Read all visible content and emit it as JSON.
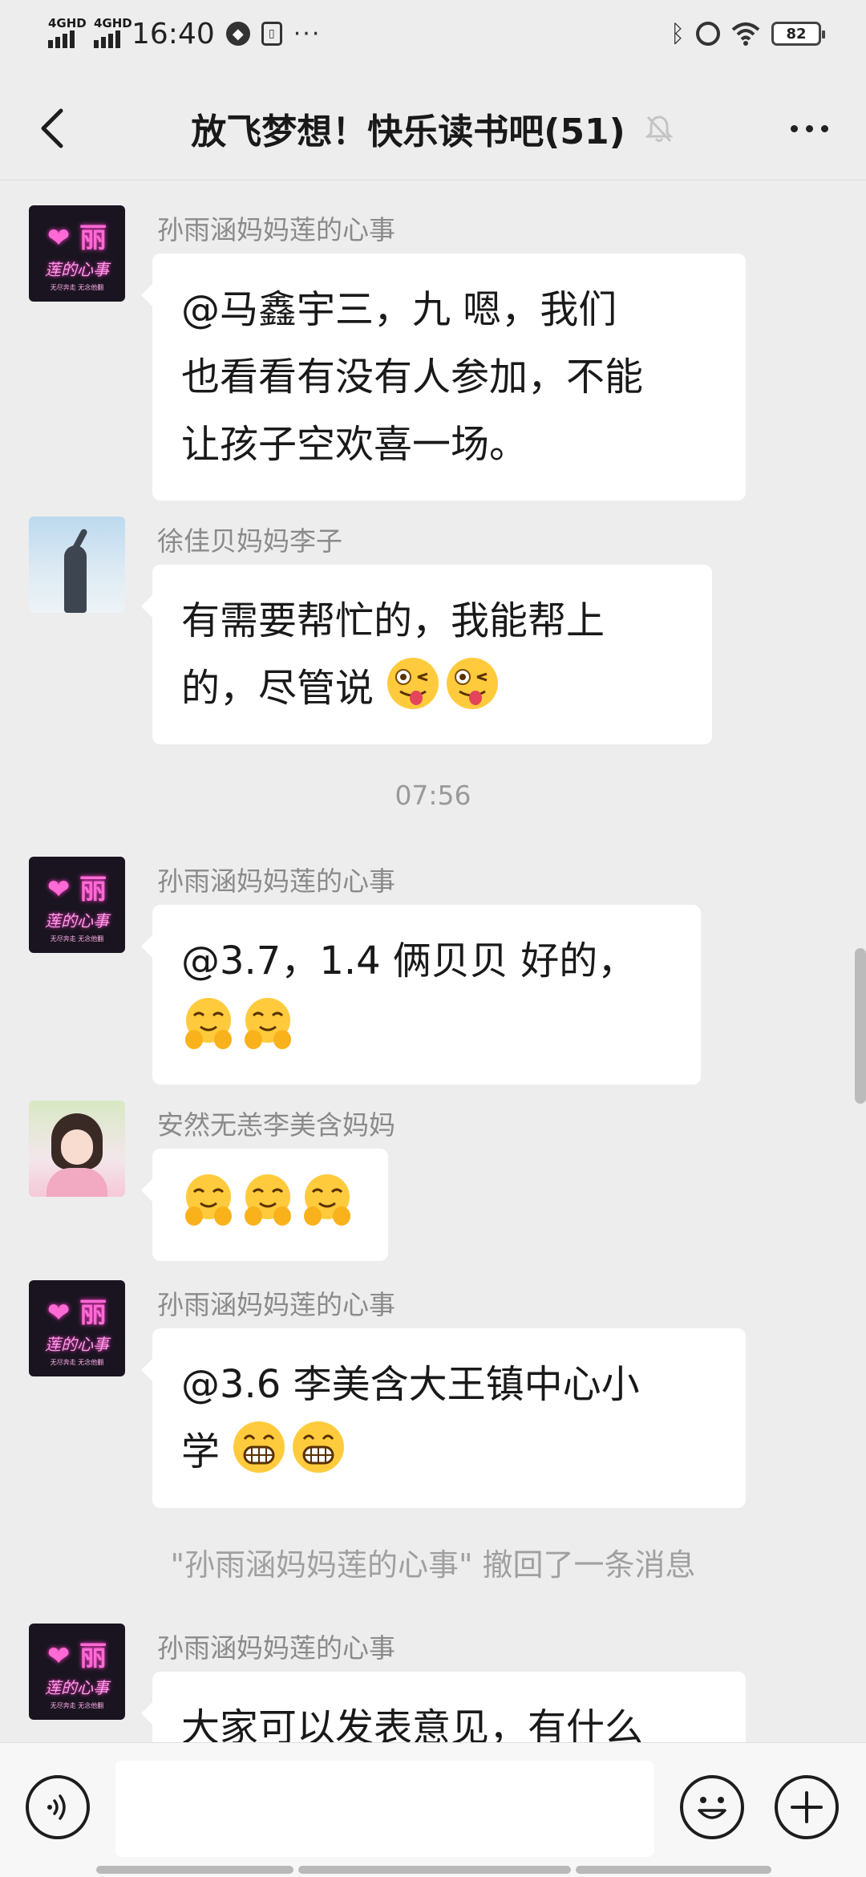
{
  "status_bar": {
    "signal_1": "4GHD",
    "signal_2": "4GHD",
    "time": "16:40",
    "more": "···",
    "battery": "82",
    "icons": [
      "signal-icon",
      "signal-icon",
      "app-notification-icon",
      "sim-icon",
      "bluetooth-icon",
      "alarm-icon",
      "wifi-icon",
      "battery-icon"
    ]
  },
  "header": {
    "title": "放飞梦想！快乐读书吧(51)",
    "icons": [
      "back-icon",
      "mute-bell-icon",
      "more-icon"
    ]
  },
  "messages": [
    {
      "sender": "孙雨涵妈妈莲的心事",
      "avatar": "neon-li",
      "avatar_text": {
        "top": "❤ 丽",
        "mid": "莲的心事",
        "bottom": "无尽奔走 无念他翻"
      },
      "lines": [
        "@马鑫宇三，九  嗯，我们",
        "也看看有没有人参加，不能",
        "让孩子空欢喜一场。"
      ]
    },
    {
      "sender": "徐佳贝妈妈李子",
      "avatar": "sky-figure",
      "lines": [
        "有需要帮忙的，我能帮上",
        "的，尽管说"
      ],
      "emojis_line_2": [
        "winking-tongue-emoji",
        "winking-tongue-emoji"
      ]
    },
    {
      "sender": "孙雨涵妈妈莲的心事",
      "avatar": "neon-li",
      "avatar_text": {
        "top": "❤ 丽",
        "mid": "莲的心事",
        "bottom": "无尽奔走 无念他翻"
      },
      "lines": [
        "@3.7，1.4 俩贝贝  好的，"
      ],
      "emojis_line_2": [
        "hugging-emoji",
        "hugging-emoji"
      ]
    },
    {
      "sender": "安然无恙李美含妈妈",
      "avatar": "girl-photo",
      "lines": [],
      "emojis_line_1": [
        "hugging-emoji",
        "hugging-emoji",
        "hugging-emoji"
      ]
    },
    {
      "sender": "孙雨涵妈妈莲的心事",
      "avatar": "neon-li",
      "avatar_text": {
        "top": "❤ 丽",
        "mid": "莲的心事",
        "bottom": "无尽奔走 无念他翻"
      },
      "lines": [
        "@3.6 李美含大王镇中心小",
        "学 "
      ],
      "emojis_line_2": [
        "grinning-emoji",
        "grinning-emoji"
      ]
    },
    {
      "sender": "孙雨涵妈妈莲的心事",
      "avatar": "neon-li",
      "avatar_text": {
        "top": "❤ 丽",
        "mid": "莲的心事",
        "bottom": "无尽奔走 无念他翻"
      },
      "lines": [
        "大家可以发表意见，有什么"
      ]
    }
  ],
  "time_divider": "07:56",
  "system_message": "\"孙雨涵妈妈莲的心事\" 撤回了一条消息",
  "input_bar": {
    "input_value": "",
    "icons": [
      "voice-icon",
      "emoji-icon",
      "plus-icon"
    ]
  },
  "colors": {
    "background": "#ededed",
    "bubble": "#ffffff",
    "sender": "#8a8a8a",
    "text": "#191919",
    "neon_pink": "#ff6ad5"
  }
}
